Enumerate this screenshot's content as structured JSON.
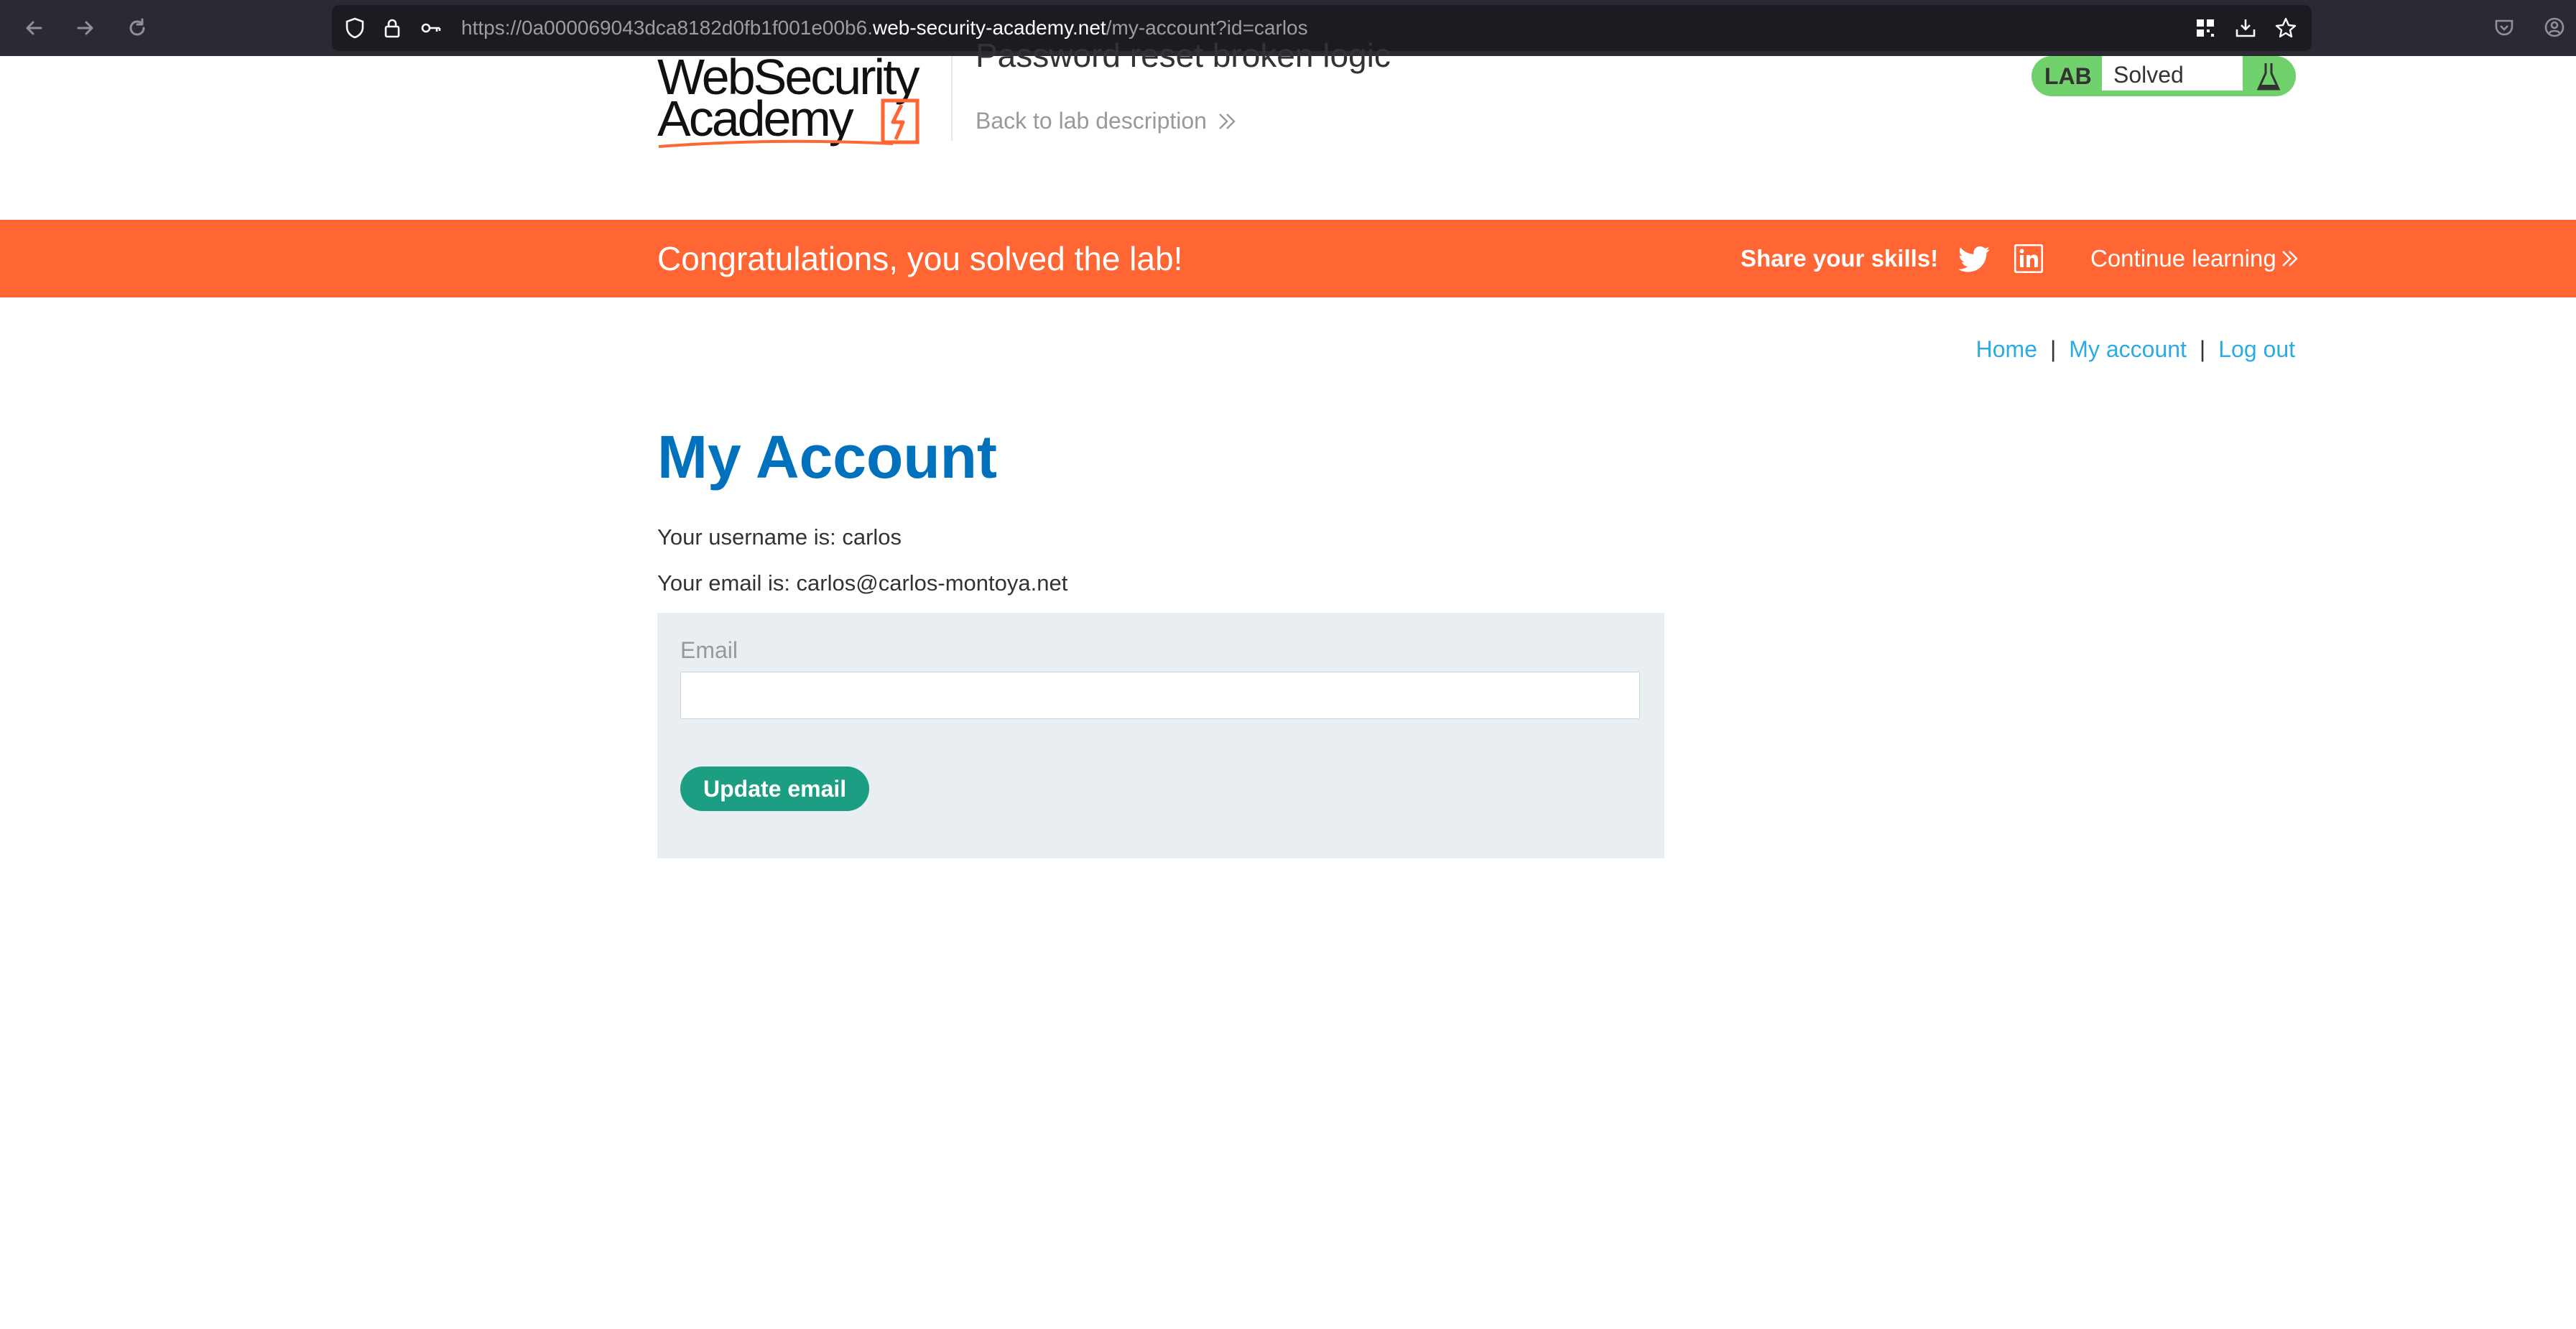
{
  "browser": {
    "url_prefix": "https://0a000069043dca8182d0fb1f001e00b6.",
    "url_domain": "web-security-academy.net",
    "url_path": "/my-account?id=carlos",
    "icons": [
      "back-icon",
      "forward-icon",
      "reload-icon",
      "shield-icon",
      "lock-icon",
      "key-icon",
      "qr-icon",
      "download-icon",
      "star-icon",
      "pocket-icon",
      "account-icon"
    ]
  },
  "header": {
    "logo_line1": "WebSecurity",
    "logo_line2": "Academy",
    "lab_title": "Password reset broken logic",
    "back_link": "Back to lab description",
    "badge_label": "LAB",
    "badge_status": "Solved"
  },
  "banner": {
    "message": "Congratulations, you solved the lab!",
    "share_label": "Share your skills!",
    "continue_label": "Continue learning"
  },
  "nav": {
    "home": "Home",
    "my_account": "My account",
    "log_out": "Log out",
    "separator": "|"
  },
  "main": {
    "title": "My Account",
    "username_line": "Your username is: carlos",
    "email_line": "Your email is: carlos@carlos-montoya.net",
    "form": {
      "email_label": "Email",
      "email_value": "",
      "submit_label": "Update email"
    }
  },
  "colors": {
    "accent": "#ff6633",
    "title_blue": "#0071bc",
    "link_blue": "#29ace5",
    "button_green": "#1b9e81",
    "badge_green": "#70d16d"
  }
}
